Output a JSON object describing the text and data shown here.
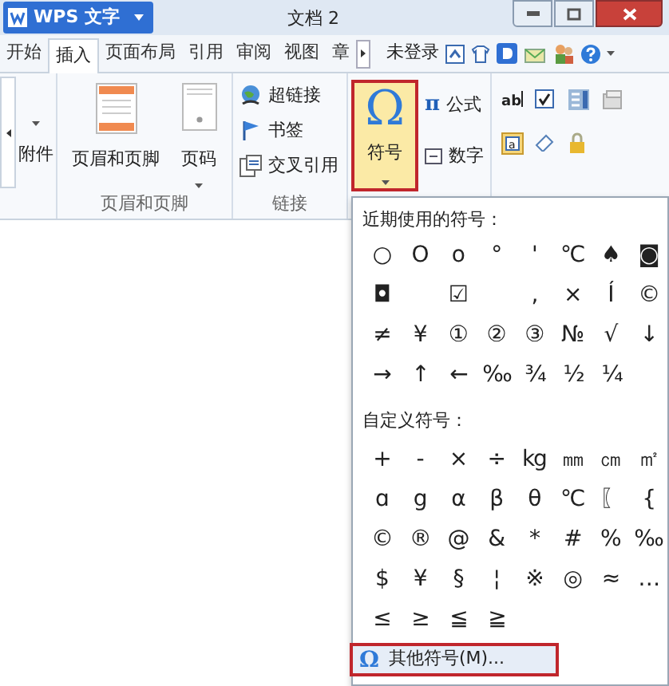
{
  "title_bar": {
    "app_button": "WPS 文字",
    "title": "文档 2"
  },
  "tabs": [
    {
      "label": "开始",
      "selected": false
    },
    {
      "label": "插入",
      "selected": true
    },
    {
      "label": "页面布局",
      "selected": false
    },
    {
      "label": "引用",
      "selected": false
    },
    {
      "label": "审阅",
      "selected": false
    },
    {
      "label": "视图",
      "selected": false
    },
    {
      "label": "章",
      "selected": false
    }
  ],
  "account": "未登录",
  "ribbon": {
    "attachment": "附件",
    "header_footer": {
      "buttons": [
        "页眉和页脚",
        "页码"
      ],
      "label": "页眉和页脚"
    },
    "links": {
      "items": [
        "超链接",
        "书签",
        "交叉引用"
      ],
      "label": "链接"
    },
    "symbol_button": {
      "icon": "Ω",
      "label": "符号",
      "expanded": true
    },
    "formula_icon": "π",
    "formula": "公式",
    "number": "数字",
    "text_field_icon": "ab",
    "design_icon": "a"
  },
  "symbol_panel": {
    "recent_title": "近期使用的符号：",
    "recent": [
      [
        {
          "kind": "symbol",
          "text": "○"
        },
        {
          "kind": "symbol",
          "text": "O"
        },
        {
          "kind": "symbol",
          "text": "o"
        },
        {
          "kind": "symbol",
          "text": "°"
        },
        {
          "kind": "symbol",
          "text": "'"
        },
        {
          "kind": "symbol",
          "text": "℃"
        },
        {
          "kind": "symbol",
          "text": "♠"
        },
        {
          "kind": "symbol",
          "text": "◙"
        }
      ],
      [
        {
          "kind": "symbol",
          "text": "◘"
        },
        {
          "kind": "blank"
        },
        {
          "kind": "symbol",
          "text": "☑"
        },
        {
          "kind": "blank"
        },
        {
          "kind": "symbol",
          "text": ","
        },
        {
          "kind": "symbol",
          "text": "×"
        },
        {
          "kind": "symbol",
          "text": "Í"
        },
        {
          "kind": "symbol",
          "text": "©"
        }
      ],
      [
        {
          "kind": "symbol",
          "text": "≠"
        },
        {
          "kind": "symbol",
          "text": "¥"
        },
        {
          "kind": "symbol",
          "text": "①"
        },
        {
          "kind": "symbol",
          "text": "②"
        },
        {
          "kind": "symbol",
          "text": "③"
        },
        {
          "kind": "symbol",
          "text": "№"
        },
        {
          "kind": "symbol",
          "text": "√"
        },
        {
          "kind": "symbol",
          "text": "↓"
        }
      ],
      [
        {
          "kind": "symbol",
          "text": "→"
        },
        {
          "kind": "symbol",
          "text": "↑"
        },
        {
          "kind": "symbol",
          "text": "←"
        },
        {
          "kind": "symbol",
          "text": "‰"
        },
        {
          "kind": "symbol",
          "text": "¾"
        },
        {
          "kind": "symbol",
          "text": "½"
        },
        {
          "kind": "symbol",
          "text": "¼"
        }
      ]
    ],
    "custom_title": "自定义符号：",
    "custom": [
      [
        {
          "kind": "symbol",
          "text": "+"
        },
        {
          "kind": "symbol",
          "text": "-"
        },
        {
          "kind": "symbol",
          "text": "×"
        },
        {
          "kind": "symbol",
          "text": "÷"
        },
        {
          "kind": "symbol",
          "text": "kg"
        },
        {
          "kind": "symbol",
          "text": "㎜"
        },
        {
          "kind": "symbol",
          "text": "㎝"
        },
        {
          "kind": "symbol",
          "text": "㎡"
        }
      ],
      [
        {
          "kind": "symbol",
          "text": "ɑ"
        },
        {
          "kind": "symbol",
          "text": "g"
        },
        {
          "kind": "symbol",
          "text": "α"
        },
        {
          "kind": "symbol",
          "text": "β"
        },
        {
          "kind": "symbol",
          "text": "θ"
        },
        {
          "kind": "symbol",
          "text": "℃"
        },
        {
          "kind": "symbol",
          "text": "〖"
        },
        {
          "kind": "symbol",
          "text": "{"
        }
      ],
      [
        {
          "kind": "symbol",
          "text": "©"
        },
        {
          "kind": "symbol",
          "text": "®"
        },
        {
          "kind": "symbol",
          "text": "@"
        },
        {
          "kind": "symbol",
          "text": "&"
        },
        {
          "kind": "symbol",
          "text": "*"
        },
        {
          "kind": "symbol",
          "text": "#"
        },
        {
          "kind": "symbol",
          "text": "%"
        },
        {
          "kind": "symbol",
          "text": "‰"
        }
      ],
      [
        {
          "kind": "symbol",
          "text": "$"
        },
        {
          "kind": "symbol",
          "text": "¥"
        },
        {
          "kind": "symbol",
          "text": "§"
        },
        {
          "kind": "symbol",
          "text": "¦"
        },
        {
          "kind": "symbol",
          "text": "※"
        },
        {
          "kind": "symbol",
          "text": "◎"
        },
        {
          "kind": "symbol",
          "text": "≈"
        },
        {
          "kind": "symbol",
          "text": "…"
        }
      ],
      [
        {
          "kind": "symbol",
          "text": "≤"
        },
        {
          "kind": "symbol",
          "text": "≥"
        },
        {
          "kind": "symbol",
          "text": "≦"
        },
        {
          "kind": "symbol",
          "text": "≧"
        }
      ]
    ],
    "more_icon": "Ω",
    "more": "其他符号(M)..."
  }
}
